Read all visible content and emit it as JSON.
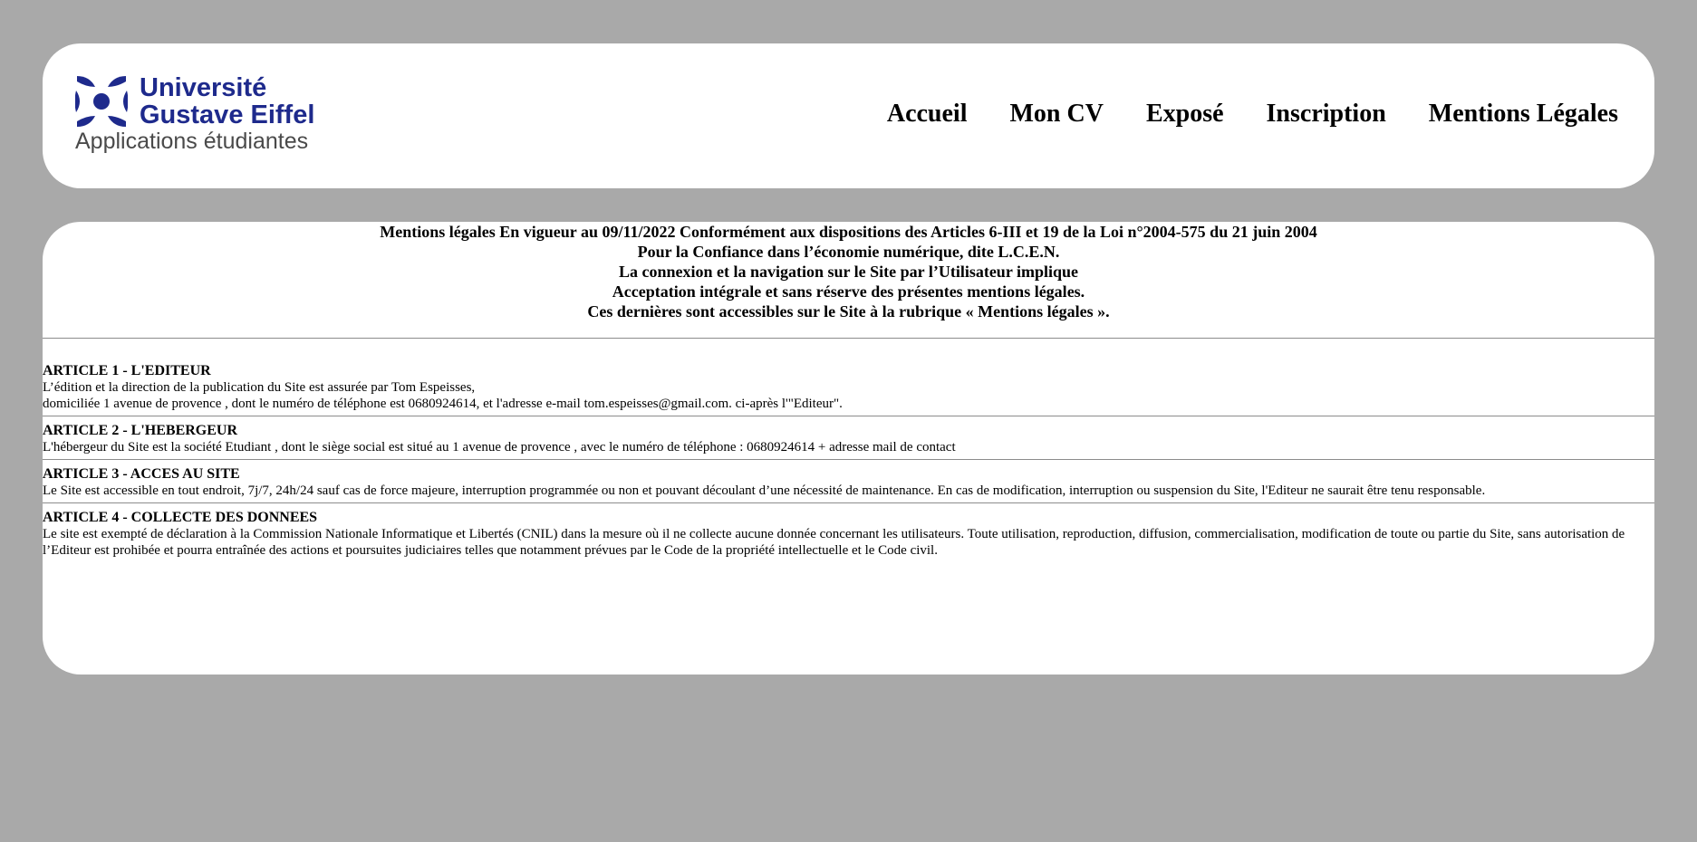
{
  "logo": {
    "line1": "Université",
    "line2": "Gustave Eiffel",
    "tagline": "Applications étudiantes",
    "brand_color": "#1e2a8c"
  },
  "nav": [
    {
      "label": "Accueil"
    },
    {
      "label": "Mon CV"
    },
    {
      "label": "Exposé"
    },
    {
      "label": "Inscription"
    },
    {
      "label": "Mentions Légales"
    }
  ],
  "intro": {
    "line1": "Mentions légales En vigueur au 09/11/2022 Conformément aux dispositions des Articles 6-III et 19 de la Loi n°2004-575 du 21 juin 2004",
    "line2": "Pour la Confiance dans l’économie numérique, dite L.C.E.N.",
    "line3": "La connexion et la navigation sur le Site par l’Utilisateur implique",
    "line4": "Acceptation intégrale et sans réserve des présentes mentions légales.",
    "line5": "Ces dernières sont accessibles sur le Site à la rubrique « Mentions légales »."
  },
  "articles": [
    {
      "title": "ARTICLE 1 - L'EDITEUR",
      "line1": "L’édition et la direction de la publication du Site est assurée par Tom Espeisses,",
      "line2": "domiciliée 1 avenue de provence , dont le numéro de téléphone est 0680924614, et l'adresse e-mail tom.espeisses@gmail.com. ci-après l'\"Editeur\"."
    },
    {
      "title": "ARTICLE 2 - L'HEBERGEUR",
      "line1": "L'hébergeur du Site est la société Etudiant , dont le siège social est situé au 1 avenue de provence , avec le numéro de téléphone : 0680924614 + adresse mail de contact"
    },
    {
      "title": "ARTICLE 3 - ACCES AU SITE",
      "line1": "Le Site est accessible en tout endroit, 7j/7, 24h/24 sauf cas de force majeure, interruption programmée ou non et pouvant découlant d’une nécessité de maintenance. En cas de modification, interruption ou suspension du Site, l'Editeur ne saurait être tenu responsable."
    },
    {
      "title": "ARTICLE 4 - COLLECTE DES DONNEES",
      "line1": "Le site est exempté de déclaration à la Commission Nationale Informatique et Libertés (CNIL) dans la mesure où il ne collecte aucune donnée concernant les utilisateurs. Toute utilisation, reproduction, diffusion, commercialisation, modification de toute ou partie du Site, sans autorisation de l’Editeur est prohibée et pourra entraînée des actions et poursuites judiciaires telles que notamment prévues par le Code de la propriété intellectuelle et le Code civil."
    }
  ]
}
